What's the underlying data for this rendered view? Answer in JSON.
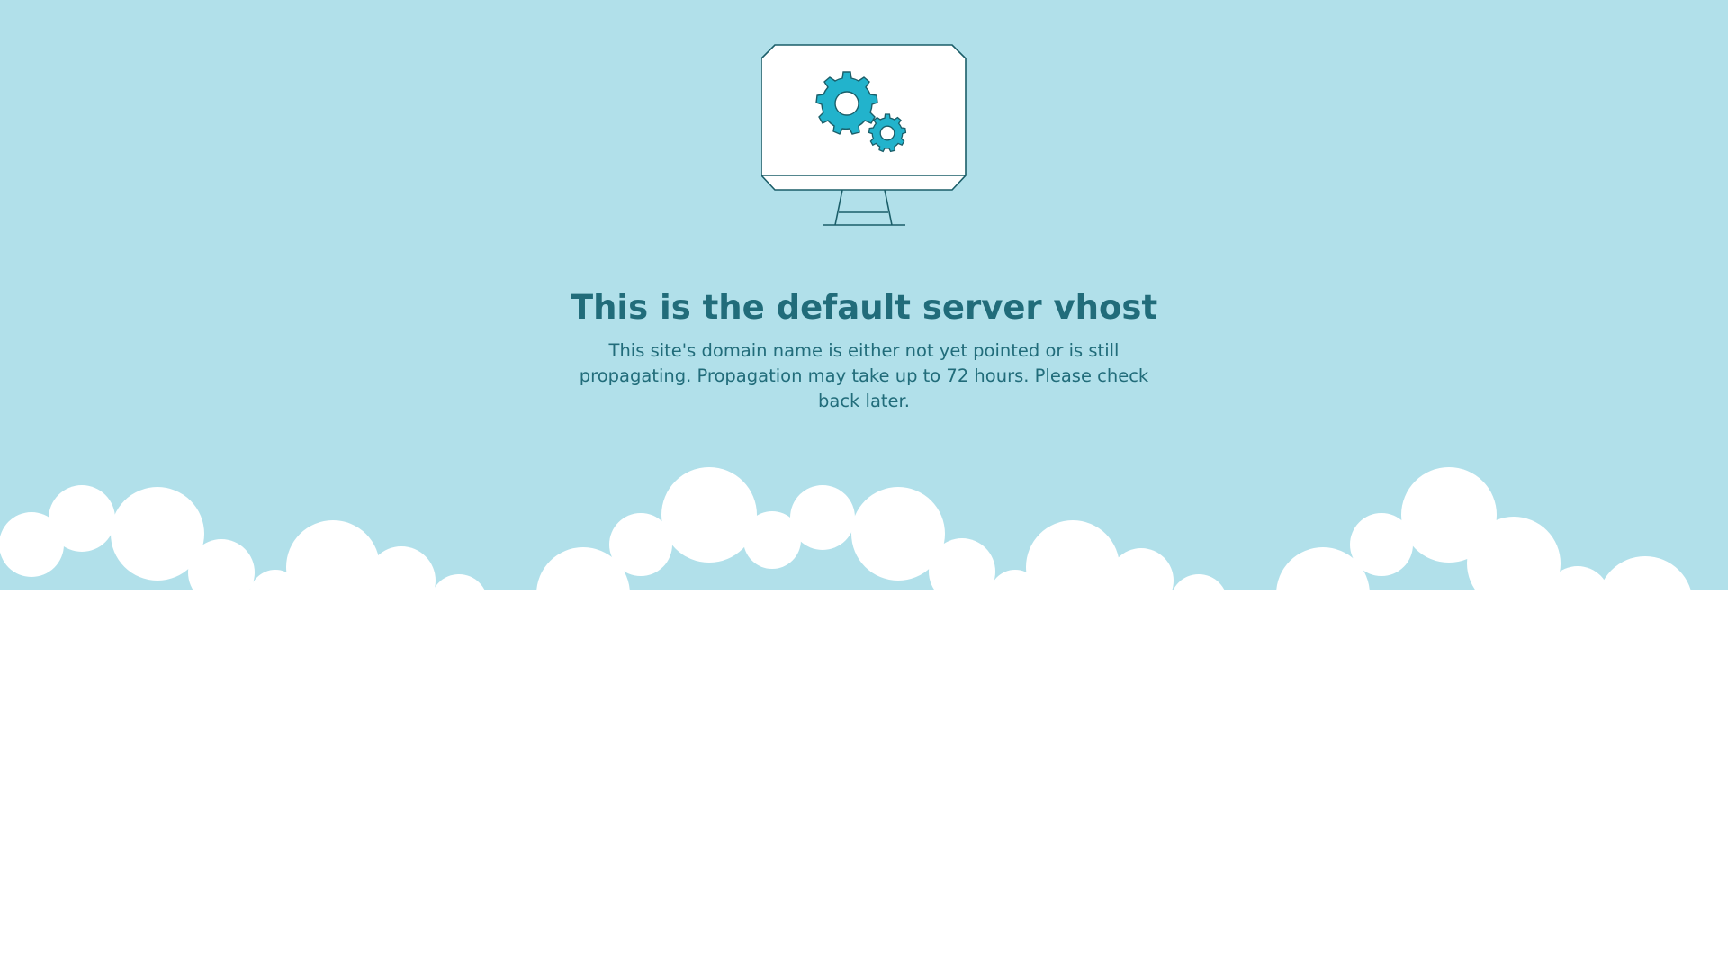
{
  "page": {
    "heading": "This is the default server vhost",
    "message": "This site's domain name is either not yet pointed or is still propagating. Propagation may take up to 72 hours. Please check back later."
  },
  "illustration": {
    "monitor_icon": "monitor-icon",
    "gear_icon": "gear-icon",
    "cloud_graphic": "clouds-graphic"
  },
  "colors": {
    "sky": "#b1e0ea",
    "text": "#216c7a",
    "gear": "#22b3cc",
    "outline": "#1b5e69",
    "cloud": "#ffffff"
  }
}
